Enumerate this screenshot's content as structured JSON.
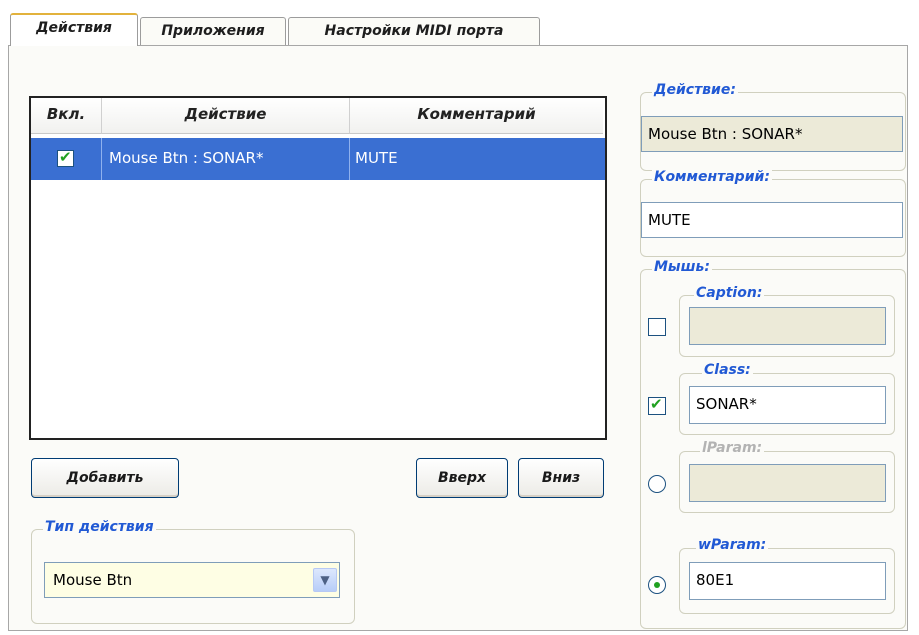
{
  "tabs": [
    {
      "label": "Действия",
      "active": true
    },
    {
      "label": "Приложения",
      "active": false
    },
    {
      "label": "Настройки MIDI порта",
      "active": false
    }
  ],
  "grid": {
    "columns": [
      "Вкл.",
      "Действие",
      "Комментарий"
    ],
    "rows": [
      {
        "enabled": true,
        "action": "Mouse Btn : SONAR*",
        "comment": "MUTE",
        "selected": true
      }
    ]
  },
  "buttons": {
    "add": "Добавить",
    "up": "Вверх",
    "down": "Вниз"
  },
  "action_type": {
    "title": "Тип действия",
    "value": "Mouse Btn"
  },
  "action": {
    "title": "Действие:",
    "value": "Mouse Btn : SONAR*"
  },
  "comment": {
    "title": "Комментарий:",
    "value": "MUTE"
  },
  "mouse": {
    "title": "Мышь:",
    "caption": {
      "title": "Caption:",
      "value": "",
      "checked": false
    },
    "class": {
      "title": "Class:",
      "value": "SONAR*",
      "checked": true
    },
    "lparam": {
      "title": "lParam:",
      "value": "",
      "selected": false
    },
    "wparam": {
      "title": "wParam:",
      "value": "80E1",
      "selected": true
    }
  },
  "colors": {
    "selection": "#3a6fd2",
    "group_title": "#2159d4",
    "check": "#21a121"
  },
  "icons": {
    "combo_arrow": "chevron-down-icon",
    "checkmark": "checkmark-icon"
  }
}
